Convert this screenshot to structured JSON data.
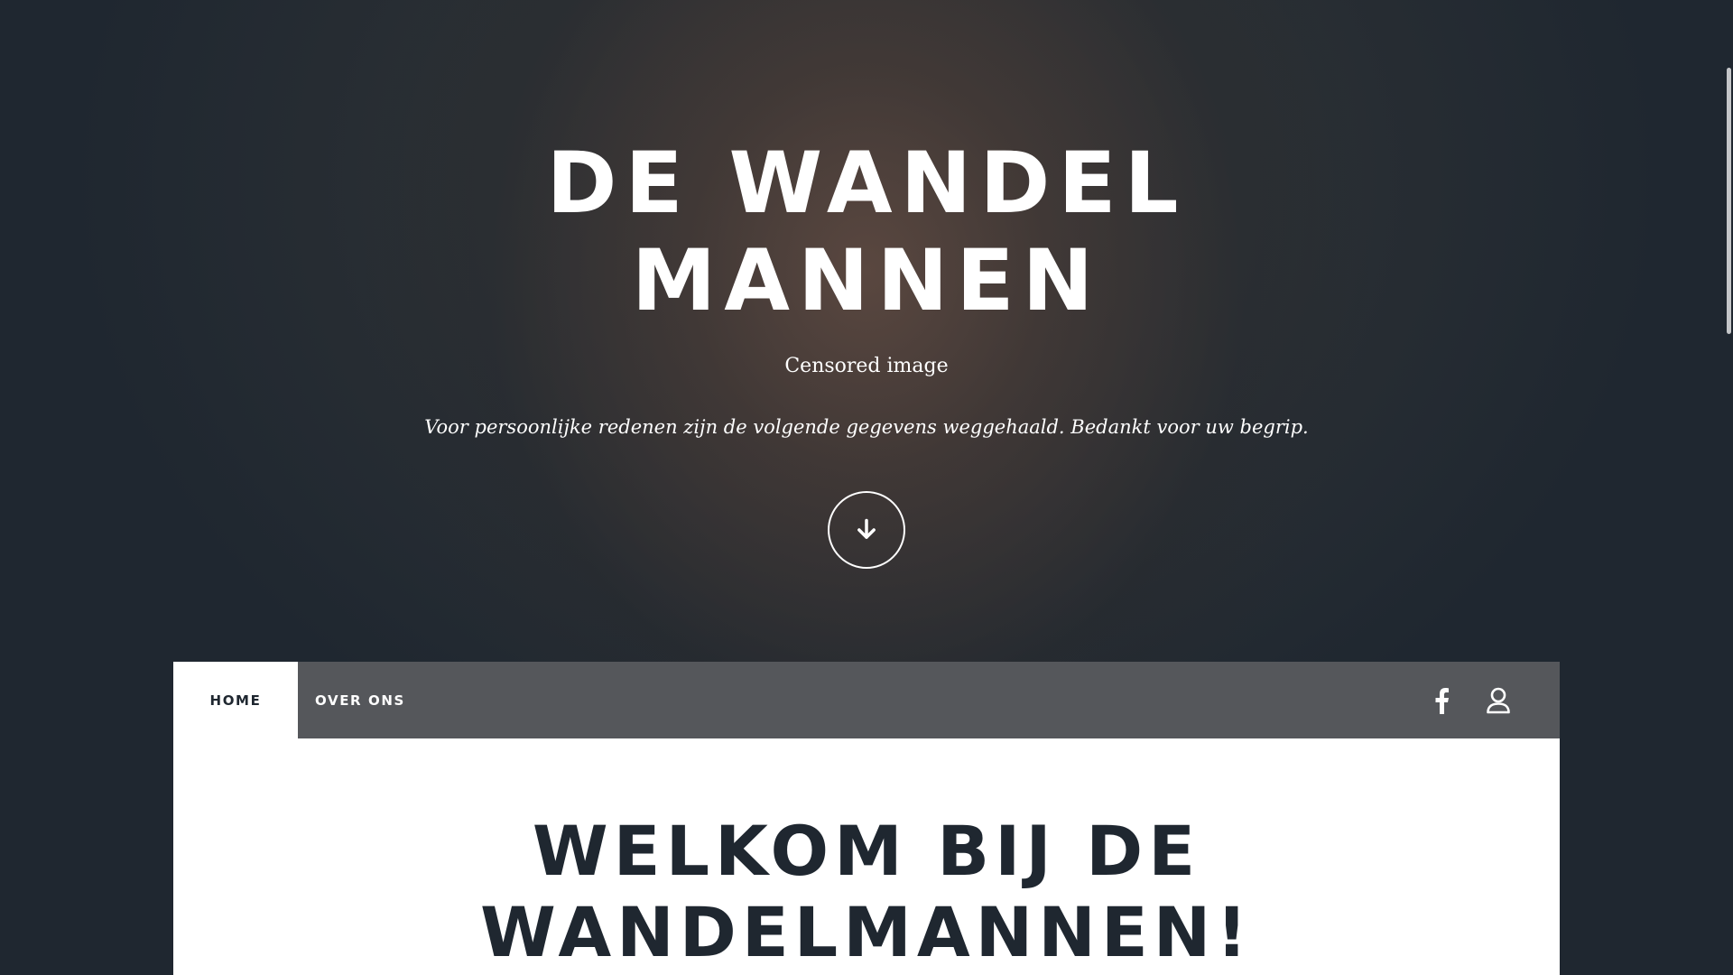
{
  "hero": {
    "title_line1": "DE WANDEL",
    "title_line2": "MANNEN",
    "tagline": "Censored image",
    "notice": "Voor persoonlijke redenen zijn de volgende gegevens weggehaald. Bedankt voor uw begrip."
  },
  "nav": {
    "tabs": [
      {
        "label": "HOME",
        "active": true
      },
      {
        "label": "OVER ONS",
        "active": false
      }
    ],
    "icons": [
      "facebook-icon",
      "user-icon"
    ]
  },
  "main": {
    "heading_line1": "WELKOM BIJ DE",
    "heading_line2": "WANDELMANNEN!"
  },
  "colors": {
    "dark": "#1f2730",
    "nav_bg": "#55575b",
    "white": "#ffffff"
  }
}
